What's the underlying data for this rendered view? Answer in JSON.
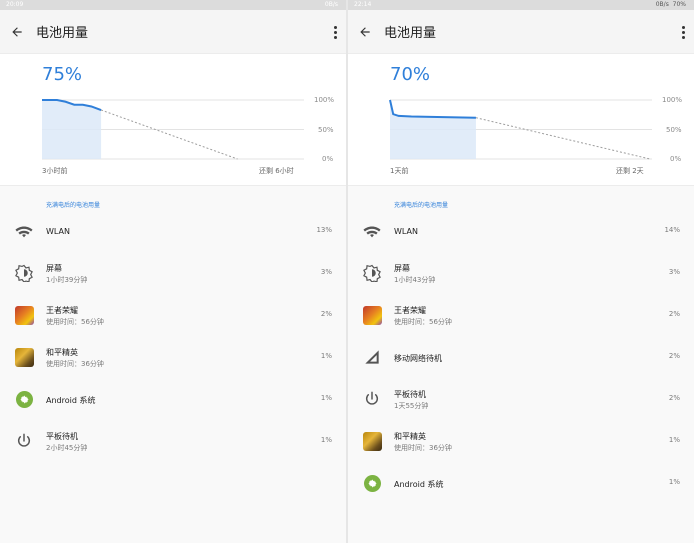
{
  "left": {
    "status": {
      "time": "20:09",
      "info": "0B/s"
    },
    "appbar": {
      "title": "电池用量"
    },
    "summary": {
      "percent": "75%"
    },
    "chart_data": {
      "type": "line",
      "y_ticks": [
        "100%",
        "50%",
        "0%"
      ],
      "x_start_label": "3小时前",
      "x_end_label": "还剩 6小时",
      "ylim": [
        0,
        100
      ],
      "x": [
        0,
        0.14,
        0.22,
        0.3,
        0.38,
        0.46,
        0.55
      ],
      "values": [
        100,
        100,
        97,
        92,
        92,
        89,
        83
      ],
      "projection": {
        "from": [
          0.55,
          83
        ],
        "to": [
          1.82,
          0
        ]
      }
    },
    "section_label": "充满电后的电池用量",
    "items": [
      {
        "name": "WLAN",
        "sub": "",
        "percent": "13%",
        "icon": "wifi-icon"
      },
      {
        "name": "屏幕",
        "sub": "1小时39分钟",
        "percent": "3%",
        "icon": "brightness-icon"
      },
      {
        "name": "王者荣耀",
        "sub": "使用时间：56分钟",
        "percent": "2%",
        "icon": "honor-of-kings-app-icon"
      },
      {
        "name": "和平精英",
        "sub": "使用时间：36分钟",
        "percent": "1%",
        "icon": "peacekeeper-elite-app-icon"
      },
      {
        "name": "Android 系统",
        "sub": "",
        "percent": "1%",
        "icon": "android-system-icon"
      },
      {
        "name": "平板待机",
        "sub": "2小时45分钟",
        "percent": "1%",
        "icon": "power-icon"
      }
    ]
  },
  "right": {
    "status": {
      "time": "22:14",
      "info": "0B/s",
      "battery": "70%"
    },
    "appbar": {
      "title": "电池用量"
    },
    "summary": {
      "percent": "70%"
    },
    "chart_data": {
      "type": "line",
      "y_ticks": [
        "100%",
        "50%",
        "0%"
      ],
      "x_start_label": "1天前",
      "x_end_label": "还剩 2天",
      "ylim": [
        0,
        100
      ],
      "x": [
        0,
        0.03,
        0.08,
        0.2,
        0.5,
        0.8
      ],
      "values": [
        100,
        76,
        73,
        72,
        71,
        70
      ],
      "projection": {
        "from": [
          0.8,
          70
        ],
        "to": [
          2.42,
          0
        ]
      }
    },
    "section_label": "充满电后的电池用量",
    "items": [
      {
        "name": "WLAN",
        "sub": "",
        "percent": "14%",
        "icon": "wifi-icon"
      },
      {
        "name": "屏幕",
        "sub": "1小时43分钟",
        "percent": "3%",
        "icon": "brightness-icon"
      },
      {
        "name": "王者荣耀",
        "sub": "使用时间：56分钟",
        "percent": "2%",
        "icon": "honor-of-kings-app-icon"
      },
      {
        "name": "移动网络待机",
        "sub": "",
        "percent": "2%",
        "icon": "cell-signal-icon"
      },
      {
        "name": "平板待机",
        "sub": "1天55分钟",
        "percent": "2%",
        "icon": "power-icon"
      },
      {
        "name": "和平精英",
        "sub": "使用时间：36分钟",
        "percent": "1%",
        "icon": "peacekeeper-elite-app-icon"
      },
      {
        "name": "Android 系统",
        "sub": "",
        "percent": "1%",
        "icon": "android-system-icon"
      }
    ]
  },
  "colors": {
    "accent": "#2f7fd9",
    "fill": "#dce9f8",
    "android": "#7cb342"
  }
}
